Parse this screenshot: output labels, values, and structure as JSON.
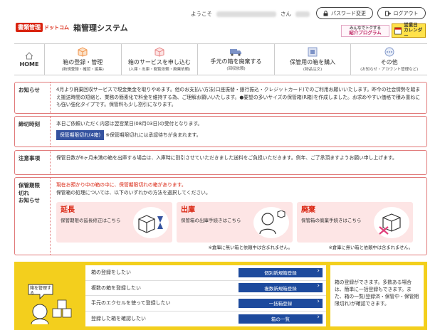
{
  "header": {
    "logo_badge": "書類管理",
    "logo_sub": "ドットコム",
    "logo_title": "箱管理システム",
    "welcome_prefix": "ようこそ",
    "welcome_suffix": "さん",
    "password_button": "パスワード変更",
    "logout_button": "ログアウト",
    "banner_referral_line1": "みんなでトクする",
    "banner_referral_line2": "紹介プログラム",
    "banner_calendar_line1": "営業日",
    "banner_calendar_line2": "カレンダー"
  },
  "nav": {
    "items": [
      {
        "label": "HOME",
        "sub": "",
        "icon": "home-icon"
      },
      {
        "label": "箱の登録・管理",
        "sub": "(新規登録・確認・編集)",
        "icon": "box-register-icon"
      },
      {
        "label": "箱のサービスを申し込む",
        "sub": "(入庫・出庫・閲覧依頼・廃棄依頼)",
        "icon": "box-service-icon"
      },
      {
        "label": "手元の箱を廃棄する",
        "sub": "(回収依頼)",
        "icon": "truck-icon"
      },
      {
        "label": "保管用の箱を購入",
        "sub": "(物品注文)",
        "icon": "box-purchase-icon"
      },
      {
        "label": "その他",
        "sub": "(お知らせ・アカウント管理など)",
        "icon": "other-icon"
      }
    ]
  },
  "notice": {
    "label": "お知らせ",
    "text_before_red": "4月より廃棄回収サービスで現金集金を取りやめます。他のお支払い方法(口座振替・銀行振込・クレジットカード)でのご利用お願いいたします。昨今の社会情勢を踏まえ搬送時間の短縮と、業務の簡素化で料金を維持する為、ご理解お願いいたします。●要望の多いサイズの保管箱(R箱)を作成しました。お求めやすい価格で積み重ねにも強い強化タイプです。保管料も少し割引になります。"
  },
  "deadline": {
    "label": "締切時刻",
    "text": "本日ご依頼いただく内容は翌営業日(08月03日)の受付となります。",
    "badge": "保管期限切れ(4箱)",
    "badge_note": "※保管期限切れには承認待ちが含まれます。"
  },
  "caution": {
    "label": "注意事項",
    "text": "保管日数が6ヶ月未満の箱を出庫する場合は、入庫時に割引させていただきました送料をご負担いただきます。例年、ご了承頂ますようお願い申し上げます。"
  },
  "expired": {
    "label_line1": "保管期限",
    "label_line2": "切れ",
    "label_line3": "お知らせ",
    "warning": "現在お預かり中の箱の中に、保管期限切れの箱があります。",
    "instruction": "保管箱の処理については、以下のいずれかの方法を選択してください。",
    "options": [
      {
        "title": "延長",
        "desc": "保管期限の延長修正はこちら",
        "icon": "box-hourglass-icon",
        "note": ""
      },
      {
        "title": "出庫",
        "desc": "保管箱の出庫手続きはこちら",
        "icon": "person-box-icon",
        "note": "※倉庫に無い箱と依頼中は含まれません。"
      },
      {
        "title": "廃棄",
        "desc": "保管箱の廃棄手続きはこちら",
        "icon": "box-dispose-icon",
        "note": "※倉庫に無い箱と依頼中は含まれません。"
      }
    ]
  },
  "bottom": {
    "illustration_text": "箱を管理する",
    "rows": [
      {
        "label": "箱の登録をしたい",
        "button": "個別新規箱登録"
      },
      {
        "label": "複数の箱を登録したい",
        "button": "複数新規箱登録"
      },
      {
        "label": "手元のエクセルを使って登録したい",
        "button": "一括箱登録"
      },
      {
        "label": "登録した箱を確認したい",
        "button": "箱の一覧"
      }
    ],
    "info": "箱の登録ができます。多数ある場合は、簡単に一括登録もできます。また、箱の一覧(登録済・保管中・保管期限切れ)が確認できます。"
  },
  "colors": {
    "accent_red": "#d9230f",
    "nav_orange": "#f08a3c",
    "button_blue": "#1d4a9d",
    "bottom_yellow": "#f3cf1d"
  }
}
